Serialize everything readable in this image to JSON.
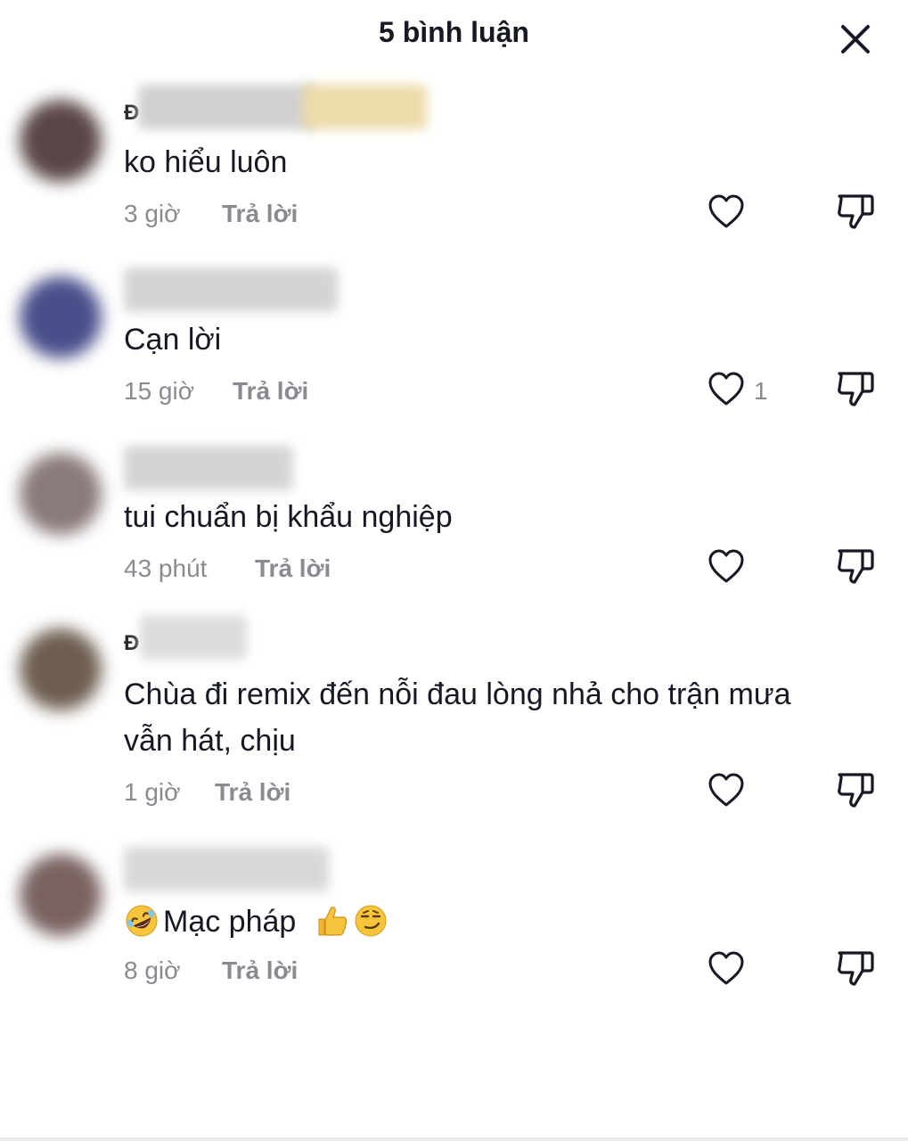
{
  "header": {
    "title": "5 bình luận",
    "close_icon": "close-icon"
  },
  "comments": [
    {
      "username_visible": "Đ",
      "text": "ko hiểu luôn",
      "time": "3 giờ",
      "reply_label": "Trả lời",
      "likes": ""
    },
    {
      "username_visible": "",
      "text": "Cạn lời",
      "time": "15 giờ",
      "reply_label": "Trả lời",
      "likes": "1"
    },
    {
      "username_visible": "",
      "text": "tui chuẩn bị khẩu nghiệp",
      "time": "43 phút",
      "reply_label": "Trả lời",
      "likes": ""
    },
    {
      "username_visible": "Đ",
      "text_line1": "Chùa đi remix đến nỗi đau lòng nhả cho trận mưa",
      "text_line2": "vẫn hát, chịu",
      "time": "1 giờ",
      "reply_label": "Trả lời",
      "likes": ""
    },
    {
      "username_visible": "",
      "text": "Mạc pháp",
      "emojis": [
        "rolling-on-floor-laughing-emoji",
        "thumbs-up-emoji",
        "smirking-face-emoji"
      ],
      "time": "8 giờ",
      "reply_label": "Trả lời",
      "likes": ""
    }
  ],
  "colors": {
    "text": "#161823",
    "meta": "#8a8b91"
  },
  "icons": {
    "like": "heart-outline-icon",
    "dislike": "thumbs-down-outline-icon"
  }
}
